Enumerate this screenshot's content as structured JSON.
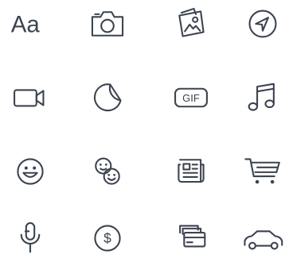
{
  "icons": [
    {
      "name": "text-format-icon",
      "label": "Aa"
    },
    {
      "name": "camera-icon"
    },
    {
      "name": "photos-icon"
    },
    {
      "name": "location-arrow-icon"
    },
    {
      "name": "video-camera-icon"
    },
    {
      "name": "sticker-icon"
    },
    {
      "name": "gif-icon",
      "label": "GIF"
    },
    {
      "name": "music-note-icon"
    },
    {
      "name": "smiley-icon"
    },
    {
      "name": "emoji-faces-icon"
    },
    {
      "name": "newspaper-icon"
    },
    {
      "name": "shopping-cart-icon"
    },
    {
      "name": "microphone-icon"
    },
    {
      "name": "dollar-icon",
      "label": "$"
    },
    {
      "name": "payment-cards-icon"
    },
    {
      "name": "car-icon"
    }
  ],
  "colors": {
    "icon_stroke": "#3c4350",
    "background": "#ffffff"
  }
}
